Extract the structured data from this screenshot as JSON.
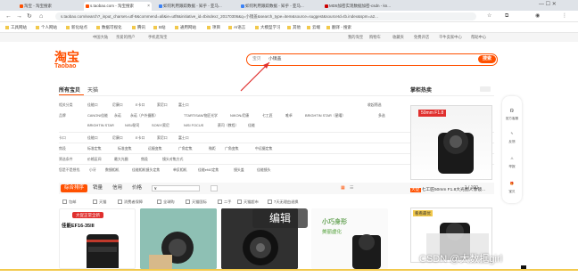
{
  "browser": {
    "tabs": [
      {
        "label": "淘宝 - 淘宝搜索",
        "active": false
      },
      {
        "label": "s.taobao.com - 淘宝搜索",
        "active": true
      },
      {
        "label": "如何利用跟踪数据 - 知乎 - 亚马...",
        "active": false
      },
      {
        "label": "如何利用跟踪数据 - 知乎 - 亚马...",
        "active": false
      },
      {
        "label": "MD5加密实现数据加密-csdn - kn...",
        "active": false
      }
    ],
    "url": "s.taobao.com/search?_input_charset=utf-8&commend=all&ie=utf8&initiative_id=tbindexz_20170306&q=小镜盖&search_type=item&source=suggest&sourceId=tb.index&spm=a2...",
    "bookmarks": [
      "工具网站",
      "个人网站",
      "新化站点",
      "数据可视化",
      "腾讯",
      "B站",
      "通用网站",
      "项目",
      "AI语言",
      "大模型学习",
      "其他",
      "云端",
      "翻译 - 搜索"
    ]
  },
  "site_nav": [
    "中国大陆",
    "亲爱的用户",
    "手机逛淘宝",
    "我的淘宝",
    "购物车",
    "收藏夹",
    "免费开店",
    "千牛卖家中心",
    "帮助中心"
  ],
  "header": {
    "logo_cn": "淘宝",
    "logo_en": "Taobao",
    "search_category": "宝贝",
    "search_query": "小镜盖",
    "search_button": "搜索"
  },
  "main_tabs": [
    "所有宝贝",
    "天猫"
  ],
  "filters": [
    {
      "label": "相关分类",
      "values": [
        "佳能口",
        "尼康口",
        "E卡口",
        "索尼口",
        "富士口"
      ],
      "extra": "收起筛选"
    },
    {
      "label": "品牌",
      "values": [
        "CANON/佳能",
        "永诺",
        "永诺（户外摄影）",
        "TTARTISAN/铭匠光学",
        "NIKON/尼康",
        "七工匠",
        "唯卓",
        "BRIGHTIN STAR（星曜）"
      ],
      "extra": "多选"
    },
    {
      "label": "",
      "values": [
        "BRIGHTIN STAR",
        "NISI/耐司",
        "SONY/索尼",
        "NISI FOCUS",
        "蔡司（教程）",
        "佳能"
      ]
    },
    {
      "label": "卡口",
      "values": [
        "佳能口",
        "尼康口",
        "E卡口",
        "索尼口",
        "富士口"
      ]
    },
    {
      "label": "焦段",
      "values": [
        "标准定焦",
        "标准变焦",
        "远摄变焦",
        "广角定焦",
        "微距",
        "广角变焦",
        "中远摄定焦"
      ]
    },
    {
      "label": "筛选条件",
      "values": [
        "价格区间",
        "最大光圈",
        "焦段",
        "镜头对焦方式"
      ]
    },
    {
      "label": "您是不是想找",
      "values": [
        "小牙",
        "数镜相机",
        "佳能相机镜头定焦",
        "单反相机",
        "佳能ef40定焦",
        "镜头盖",
        "佳能镜头"
      ]
    }
  ],
  "sort": {
    "items": [
      "综合排序",
      "销量",
      "信用",
      "价格"
    ],
    "price_from": "¥",
    "price_to": "¥",
    "pager": "1 / 100"
  },
  "options": [
    "包邮",
    "天猫",
    "消费者保障",
    "全球购",
    "天猫国际",
    "二手",
    "天猫超市",
    "7天无理由退换"
  ],
  "products": [
    {
      "label": "佳能EF16-35III",
      "badge": "大促正常全新"
    },
    {
      "label": "",
      "badge": ""
    },
    {
      "label": "",
      "badge": ""
    },
    {
      "label": "小巧身形",
      "sub": "美丽虚化"
    }
  ],
  "sidebar": {
    "title": "掌柜热卖",
    "hot_item_text": "七工匠50mm F1.8大光圈人像镜...",
    "hot_tag": "大促",
    "hot_ad_title": "50mm F1.8",
    "hot_item2_badge": "看看最优"
  },
  "right_panel": [
    "官方客服",
    "反馈",
    "举报",
    "宝贝"
  ],
  "overlays": {
    "edit_button": "编辑",
    "watermark": "CSDN @大数据girl"
  },
  "colors": {
    "accent": "#ff5000",
    "tab_bg": "#dfe3e8"
  }
}
